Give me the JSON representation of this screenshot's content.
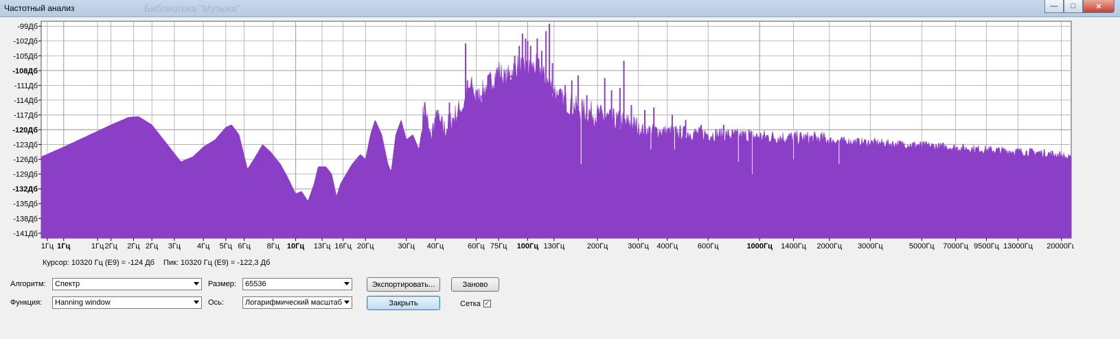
{
  "window": {
    "title": "Частотный анализ",
    "background_title": "Библиотека \"Музыка\""
  },
  "colors": {
    "spectrum": "#8a3fc6",
    "grid": "#a8a8a8",
    "plot_bg": "#ffffff"
  },
  "chart_data": {
    "type": "area",
    "x_scale": "log",
    "y_unit": "dB",
    "grid": true,
    "xlim": [
      0.8,
      22050
    ],
    "ylim": [
      -142,
      -98
    ],
    "y_ticks": [
      {
        "v": -99,
        "label": "-99Дб",
        "bold": false
      },
      {
        "v": -102,
        "label": "-102Дб",
        "bold": false
      },
      {
        "v": -105,
        "label": "-105Дб",
        "bold": false
      },
      {
        "v": -108,
        "label": "-108Дб",
        "bold": true
      },
      {
        "v": -111,
        "label": "-111Дб",
        "bold": false
      },
      {
        "v": -114,
        "label": "-114Дб",
        "bold": false
      },
      {
        "v": -117,
        "label": "-117Дб",
        "bold": false
      },
      {
        "v": -120,
        "label": "-120Дб",
        "bold": true
      },
      {
        "v": -123,
        "label": "-123Дб",
        "bold": false
      },
      {
        "v": -126,
        "label": "-126Дб",
        "bold": false
      },
      {
        "v": -129,
        "label": "-129Дб",
        "bold": false
      },
      {
        "v": -132,
        "label": "-132Дб",
        "bold": true
      },
      {
        "v": -135,
        "label": "-135Дб",
        "bold": false
      },
      {
        "v": -138,
        "label": "-138Дб",
        "bold": false
      },
      {
        "v": -141,
        "label": "-141Дб",
        "bold": false
      }
    ],
    "x_ticks": [
      {
        "v": 0.85,
        "label": "1Гц",
        "bold": false
      },
      {
        "v": 1,
        "label": "1Гц",
        "bold": true
      },
      {
        "v": 1.4,
        "label": "1Гц",
        "bold": false
      },
      {
        "v": 1.6,
        "label": "2Гц",
        "bold": false
      },
      {
        "v": 2.0,
        "label": "2Гц",
        "bold": false
      },
      {
        "v": 2.4,
        "label": "2Гц",
        "bold": false
      },
      {
        "v": 3,
        "label": "3Гц",
        "bold": false
      },
      {
        "v": 4,
        "label": "4Гц",
        "bold": false
      },
      {
        "v": 5,
        "label": "5Гц",
        "bold": false
      },
      {
        "v": 6,
        "label": "6Гц",
        "bold": false
      },
      {
        "v": 8,
        "label": "8Гц",
        "bold": false
      },
      {
        "v": 10,
        "label": "10Гц",
        "bold": true
      },
      {
        "v": 13,
        "label": "13Гц",
        "bold": false
      },
      {
        "v": 16,
        "label": "16Гц",
        "bold": false
      },
      {
        "v": 20,
        "label": "20Гц",
        "bold": false
      },
      {
        "v": 30,
        "label": "30Гц",
        "bold": false
      },
      {
        "v": 40,
        "label": "40Гц",
        "bold": false
      },
      {
        "v": 60,
        "label": "60Гц",
        "bold": false
      },
      {
        "v": 75,
        "label": "75Гц",
        "bold": false
      },
      {
        "v": 100,
        "label": "100Гц",
        "bold": true
      },
      {
        "v": 130,
        "label": "130Гц",
        "bold": false
      },
      {
        "v": 200,
        "label": "200Гц",
        "bold": false
      },
      {
        "v": 300,
        "label": "300Гц",
        "bold": false
      },
      {
        "v": 400,
        "label": "400Гц",
        "bold": false
      },
      {
        "v": 600,
        "label": "600Гц",
        "bold": false
      },
      {
        "v": 1000,
        "label": "1000Гц",
        "bold": true
      },
      {
        "v": 1400,
        "label": "1400Гц",
        "bold": false
      },
      {
        "v": 2000,
        "label": "2000Гц",
        "bold": false
      },
      {
        "v": 3000,
        "label": "3000Гц",
        "bold": false
      },
      {
        "v": 5000,
        "label": "5000Гц",
        "bold": false
      },
      {
        "v": 7000,
        "label": "7000Гц",
        "bold": false
      },
      {
        "v": 9500,
        "label": "9500Гц",
        "bold": false
      },
      {
        "v": 13000,
        "label": "13000Гц",
        "bold": false
      },
      {
        "v": 20000,
        "label": "20000Гц",
        "bold": false
      }
    ],
    "envelope": [
      [
        0.8,
        -125.5
      ],
      [
        1.0,
        -123.5
      ],
      [
        1.3,
        -121
      ],
      [
        1.6,
        -119
      ],
      [
        1.9,
        -117.5
      ],
      [
        2.1,
        -117.3
      ],
      [
        2.4,
        -119
      ],
      [
        2.8,
        -123
      ],
      [
        3.2,
        -126.5
      ],
      [
        3.6,
        -125.5
      ],
      [
        4.0,
        -123.5
      ],
      [
        4.5,
        -122
      ],
      [
        5.0,
        -119.5
      ],
      [
        5.3,
        -119
      ],
      [
        5.7,
        -121
      ],
      [
        6.2,
        -128
      ],
      [
        6.6,
        -126
      ],
      [
        7.2,
        -123
      ],
      [
        7.8,
        -124.5
      ],
      [
        8.6,
        -127
      ],
      [
        9.2,
        -129.5
      ],
      [
        10.0,
        -133
      ],
      [
        10.6,
        -132.5
      ],
      [
        11.3,
        -134.5
      ],
      [
        12.0,
        -131
      ],
      [
        12.5,
        -127.5
      ],
      [
        13.5,
        -127.5
      ],
      [
        14.3,
        -129
      ],
      [
        15.0,
        -133.5
      ],
      [
        15.6,
        -131
      ],
      [
        16.5,
        -129
      ],
      [
        17.5,
        -127
      ],
      [
        19.0,
        -125
      ],
      [
        20.0,
        -126
      ],
      [
        21.0,
        -121
      ],
      [
        22.0,
        -118
      ],
      [
        23.5,
        -121
      ],
      [
        25.0,
        -127
      ],
      [
        25.8,
        -128.5
      ],
      [
        27.0,
        -121
      ],
      [
        28.5,
        -118
      ],
      [
        30.0,
        -122
      ],
      [
        32.0,
        -121
      ],
      [
        34.0,
        -124
      ],
      [
        36.0,
        -116
      ],
      [
        38.0,
        -123
      ],
      [
        40.0,
        -119
      ],
      [
        44.0,
        -121
      ],
      [
        48.0,
        -118.5
      ],
      [
        53.0,
        -116
      ],
      [
        57.0,
        -112
      ],
      [
        60.0,
        -115
      ],
      [
        65.0,
        -113
      ],
      [
        70.0,
        -111
      ],
      [
        75.0,
        -109
      ],
      [
        80.0,
        -111
      ],
      [
        90.0,
        -108
      ],
      [
        100.0,
        -109
      ],
      [
        110.0,
        -108
      ],
      [
        120.0,
        -111
      ],
      [
        140.0,
        -115
      ],
      [
        170.0,
        -117
      ],
      [
        200.0,
        -118
      ],
      [
        250.0,
        -119.5
      ],
      [
        300.0,
        -120.5
      ],
      [
        400.0,
        -121
      ],
      [
        600.0,
        -121.5
      ],
      [
        1000.0,
        -122
      ],
      [
        2000.0,
        -122.5
      ],
      [
        5000.0,
        -123.5
      ],
      [
        10000.0,
        -124.5
      ],
      [
        16000.0,
        -125
      ],
      [
        20000.0,
        -125.5
      ],
      [
        22050.0,
        -126.5
      ]
    ],
    "peaks": [
      [
        36.0,
        -114.5
      ],
      [
        41.0,
        -116
      ],
      [
        46.0,
        -114.5
      ],
      [
        51.0,
        -116
      ],
      [
        54.0,
        -102.5
      ],
      [
        55.0,
        -110
      ],
      [
        60.0,
        -112
      ],
      [
        63.0,
        -113
      ],
      [
        66.0,
        -113.5
      ],
      [
        70.0,
        -111
      ],
      [
        73.0,
        -110.5
      ],
      [
        80.0,
        -112
      ],
      [
        85.0,
        -109
      ],
      [
        88.0,
        -105
      ],
      [
        92.0,
        -103
      ],
      [
        95.0,
        -100.5
      ],
      [
        98.0,
        -101.5
      ],
      [
        100.0,
        -102
      ],
      [
        103.0,
        -103
      ],
      [
        110.0,
        -101.5
      ],
      [
        115.0,
        -104
      ],
      [
        120.0,
        -100
      ],
      [
        124.0,
        -98.5
      ],
      [
        128.0,
        -106.5
      ],
      [
        135.0,
        -113
      ],
      [
        145.0,
        -111
      ],
      [
        155.0,
        -110
      ],
      [
        165.0,
        -109
      ],
      [
        180.0,
        -113
      ],
      [
        200.0,
        -116
      ],
      [
        215.0,
        -109.5
      ],
      [
        230.0,
        -112
      ],
      [
        250.0,
        -111.5
      ],
      [
        260.0,
        -106
      ],
      [
        280.0,
        -115
      ],
      [
        320.0,
        -116
      ],
      [
        350.0,
        -115.5
      ],
      [
        420.0,
        -117
      ],
      [
        480.0,
        -118
      ],
      [
        560.0,
        -119
      ],
      [
        700.0,
        -119
      ],
      [
        900.0,
        -120
      ]
    ],
    "dips": [
      [
        170.0,
        -127
      ],
      [
        340.0,
        -124
      ],
      [
        430.0,
        -124
      ],
      [
        810.0,
        -126.5
      ],
      [
        930.0,
        -129
      ],
      [
        1400.0,
        -126
      ],
      [
        2200.0,
        -127
      ]
    ]
  },
  "status": {
    "cursor": "Курсор: 10320 Гц (E9) = -124 Дб",
    "peak": "Пик: 10320 Гц (E9) = -122,3 Дб"
  },
  "controls": {
    "algorithm_label": "Алгоритм:",
    "algorithm_value": "Спектр",
    "function_label": "Функция:",
    "function_value": "Hanning window",
    "size_label": "Размер:",
    "size_value": "65536",
    "axis_label": "Ось:",
    "axis_value": "Логарифмический масштаб",
    "export_button": "Экспортировать...",
    "replot_button": "Заново",
    "close_button": "Закрыть",
    "grid_label": "Сетка",
    "grid_checked": true
  }
}
